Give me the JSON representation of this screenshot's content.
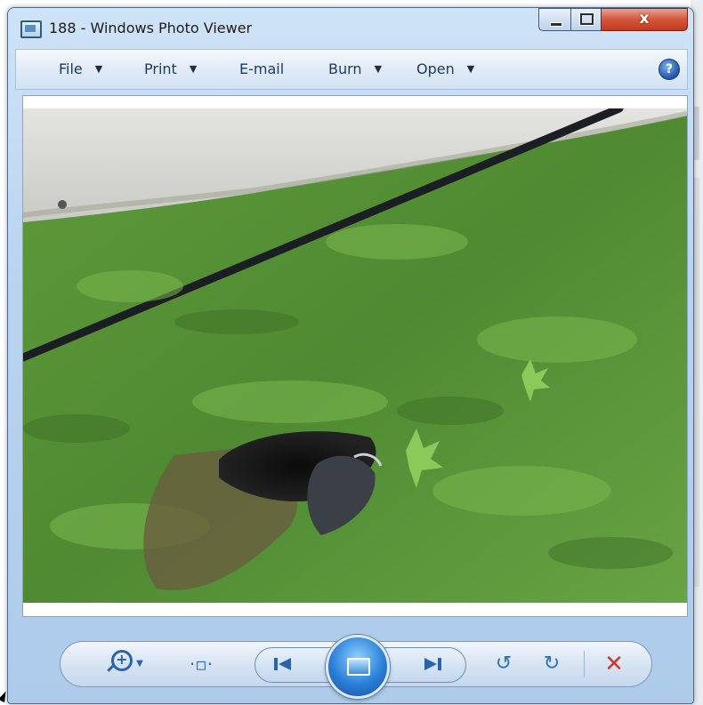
{
  "window": {
    "title": "188 - Windows Photo Viewer",
    "close_label": "x"
  },
  "menu": {
    "file": "File",
    "print": "Print",
    "email": "E-mail",
    "burn": "Burn",
    "open": "Open",
    "dropdown_arrow": "▼",
    "help_label": "?"
  },
  "controls": {
    "fit_glyph": "·▫·",
    "rotate_ccw_glyph": "↺",
    "rotate_cw_glyph": "↻",
    "delete_glyph": "✕"
  },
  "colors": {
    "accent": "#2f6db7",
    "delete": "#d8342b",
    "close_button": "#c43b20"
  }
}
